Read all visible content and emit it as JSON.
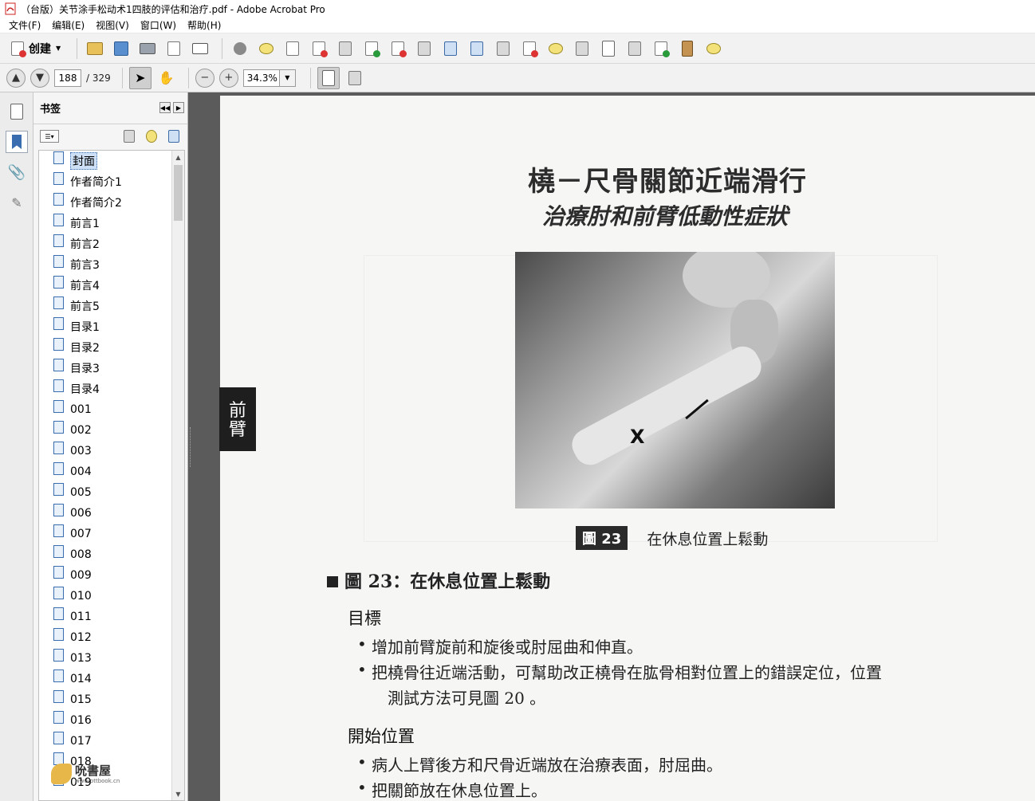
{
  "window": {
    "title": "（台版）关节涂手松动术1四肢的评估和治疗.pdf - Adobe Acrobat Pro"
  },
  "menubar": {
    "items": [
      "文件(F)",
      "编辑(E)",
      "视图(V)",
      "窗口(W)",
      "帮助(H)"
    ]
  },
  "toolbar": {
    "create_label": "创建"
  },
  "navigation": {
    "current_page": "188",
    "total_pages": "/ 329",
    "zoom": "34.3%"
  },
  "bookmarks": {
    "header": "书签",
    "items": [
      "封面",
      "作者简介1",
      "作者简介2",
      "前言1",
      "前言2",
      "前言3",
      "前言4",
      "前言5",
      "目录1",
      "目录2",
      "目录3",
      "目录4",
      "001",
      "002",
      "003",
      "004",
      "005",
      "006",
      "007",
      "008",
      "009",
      "010",
      "011",
      "012",
      "013",
      "014",
      "015",
      "016",
      "017",
      "018",
      "019"
    ],
    "selected_index": 0
  },
  "watermark": {
    "text": "吮書屋",
    "url": "www.pttbook.cn"
  },
  "page": {
    "side_tab": [
      "前",
      "臂"
    ],
    "title": "橈－尺骨關節近端滑行",
    "subtitle": "治療肘和前臂低動性症狀",
    "photo_mark": "X",
    "figure_label": "圖 23",
    "figure_caption": "在休息位置上鬆動",
    "section_heading": "圖 23：在休息位置上鬆動",
    "goal_heading": "目標",
    "goal_bullets": [
      "增加前臂旋前和旋後或肘屈曲和伸直。",
      "把橈骨往近端活動，可幫助改正橈骨在肱骨相對位置上的錯誤定位，位置"
    ],
    "goal_continuation": "測試方法可見圖 20 。",
    "start_heading": "開始位置",
    "start_bullets": [
      "病人上臂後方和尺骨近端放在治療表面，肘屈曲。",
      "把關節放在休息位置上。"
    ]
  }
}
